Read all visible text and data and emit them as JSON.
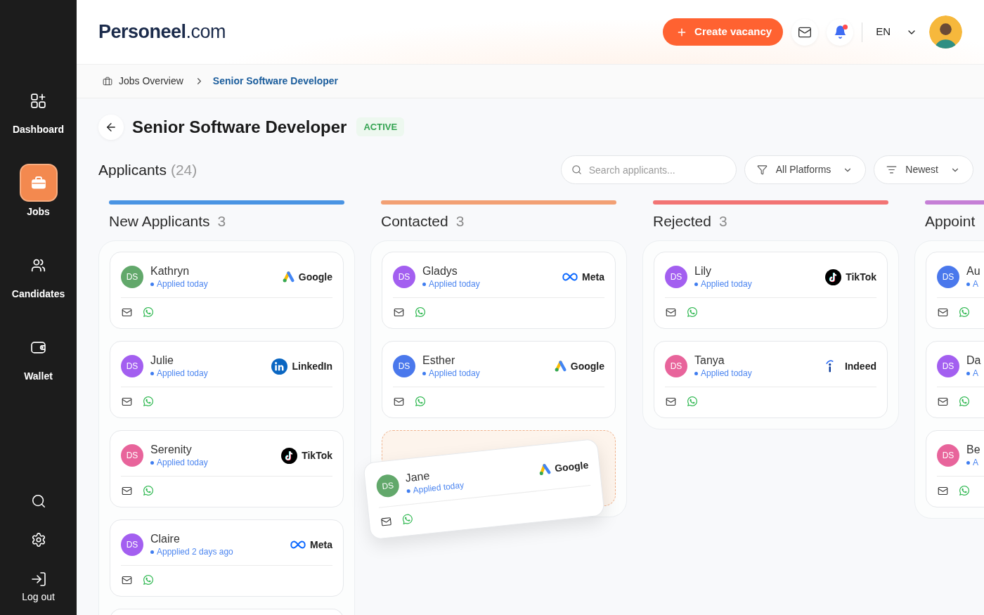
{
  "sidebar": {
    "items": [
      {
        "kind": "dashboard",
        "label": "Dashboard",
        "selected": false
      },
      {
        "kind": "jobs",
        "label": "Jobs",
        "selected": true
      },
      {
        "kind": "candidates",
        "label": "Candidates",
        "selected": false
      },
      {
        "kind": "wallet",
        "label": "Wallet",
        "selected": false
      }
    ],
    "bottom_items": [
      {
        "kind": "search"
      },
      {
        "kind": "settings"
      },
      {
        "kind": "logout",
        "label": "Log out"
      }
    ]
  },
  "header": {
    "logo": "**Personeel**.com",
    "create_button": "Create vacancy",
    "notifications": {
      "unread": true
    },
    "language": "EN"
  },
  "breadcrumb": {
    "items": [
      {
        "label": "Jobs Overview",
        "current": false
      },
      {
        "label": "Senior Software Developer",
        "current": true
      }
    ]
  },
  "job": {
    "title": "Senior Software Developer",
    "status": {
      "kind": "active",
      "label": "ACTIVE"
    }
  },
  "applicants": {
    "label": "Applicants",
    "count": "(24)",
    "search": {
      "placeholder": "Search applicants..."
    },
    "filters": [
      {
        "kind": "platform",
        "label": "All Platforms"
      },
      {
        "kind": "sort",
        "label": "Newest"
      }
    ]
  },
  "columns": [
    {
      "title": "New Applicants",
      "count": "3",
      "color": "#4a94e3",
      "has_more": true,
      "cards": [
        {
          "initials": "DS",
          "color": "#62a86b",
          "name": "Kathryn",
          "status": "Applied today",
          "platform": {
            "kind": "google",
            "label": "Google"
          },
          "dragging": false
        },
        {
          "initials": "DS",
          "color": "#a35ff0",
          "name": "Julie",
          "status": "Applied today",
          "platform": {
            "kind": "linkedin",
            "label": "LinkedIn"
          },
          "dragging": false
        },
        {
          "initials": "DS",
          "color": "#e8649b",
          "name": "Serenity",
          "status": "Applied today",
          "platform": {
            "kind": "tiktok",
            "label": "TikTok"
          },
          "dragging": false
        },
        {
          "initials": "DS",
          "color": "#a35ff0",
          "name": "Claire",
          "status": "Appplied 2 days ago",
          "platform": {
            "kind": "meta",
            "label": "Meta"
          },
          "dragging": false
        }
      ]
    },
    {
      "title": "Contacted",
      "count": "3",
      "color": "#f2a074",
      "has_more": false,
      "cards": [
        {
          "initials": "DS",
          "color": "#a35ff0",
          "name": "Gladys",
          "status": "Applied today",
          "platform": {
            "kind": "meta",
            "label": "Meta"
          },
          "dragging": false
        },
        {
          "initials": "DS",
          "color": "#4a78ec",
          "name": "Esther",
          "status": "Applied today",
          "platform": {
            "kind": "google",
            "label": "Google"
          },
          "dragging": false
        },
        {
          "initials": "DS",
          "color": "#62a86b",
          "name": "Jane",
          "status": "Applied today",
          "platform": {
            "kind": "google",
            "label": "Google"
          },
          "dragging": true
        }
      ]
    },
    {
      "title": "Rejected",
      "count": "3",
      "color": "#f27474",
      "has_more": false,
      "cards": [
        {
          "initials": "DS",
          "color": "#a35ff0",
          "name": "Lily",
          "status": "Applied today",
          "platform": {
            "kind": "tiktok",
            "label": "TikTok"
          },
          "dragging": false
        },
        {
          "initials": "DS",
          "color": "#e8649b",
          "name": "Tanya",
          "status": "Applied today",
          "platform": {
            "kind": "indeed",
            "label": "Indeed"
          },
          "dragging": false
        }
      ]
    },
    {
      "title": "Appoint",
      "color": "#c57fd6",
      "has_more": false,
      "cards": [
        {
          "initials": "DS",
          "color": "#4a78ec",
          "name": "Au",
          "status": "A",
          "dragging": false
        },
        {
          "initials": "DS",
          "color": "#a35ff0",
          "name": "Da",
          "status": "A",
          "dragging": false
        },
        {
          "initials": "DS",
          "color": "#e8649b",
          "name": "Be",
          "status": "A",
          "dragging": false
        }
      ]
    }
  ]
}
